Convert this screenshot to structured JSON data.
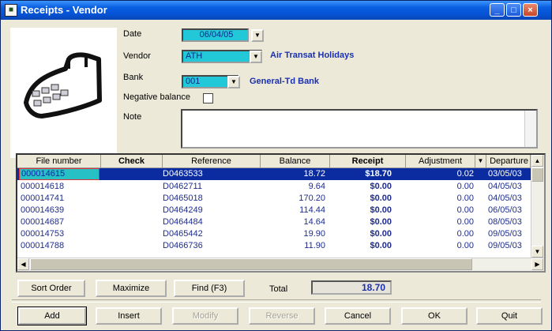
{
  "window": {
    "title": "Receipts - Vendor",
    "controls": {
      "minimize": "_",
      "maximize": "□",
      "close": "×"
    }
  },
  "form": {
    "date": {
      "label": "Date",
      "value": "06/04/05"
    },
    "vendor": {
      "label": "Vendor",
      "code": "ATH",
      "name": "Air Transat Holidays"
    },
    "bank": {
      "label": "Bank",
      "code": "001",
      "name": "General-Td Bank"
    },
    "negative_balance": {
      "label": "Negative balance",
      "checked": false
    },
    "note": {
      "label": "Note",
      "value": ""
    }
  },
  "grid": {
    "columns": [
      "File number",
      "Check",
      "Reference",
      "Balance",
      "Receipt",
      "Adjustment",
      "Departure"
    ],
    "rows": [
      {
        "file": "000014615",
        "check": "",
        "reference": "D0463533",
        "balance": "18.72",
        "receipt": "$18.70",
        "adjustment": "0.02",
        "departure": "03/05/03",
        "selected": true
      },
      {
        "file": "000014618",
        "check": "",
        "reference": "D0462711",
        "balance": "9.64",
        "receipt": "$0.00",
        "adjustment": "0.00",
        "departure": "04/05/03"
      },
      {
        "file": "000014741",
        "check": "",
        "reference": "D0465018",
        "balance": "170.20",
        "receipt": "$0.00",
        "adjustment": "0.00",
        "departure": "04/05/03"
      },
      {
        "file": "000014639",
        "check": "",
        "reference": "D0464249",
        "balance": "114.44",
        "receipt": "$0.00",
        "adjustment": "0.00",
        "departure": "06/05/03"
      },
      {
        "file": "000014687",
        "check": "",
        "reference": "D0464484",
        "balance": "14.64",
        "receipt": "$0.00",
        "adjustment": "0.00",
        "departure": "08/05/03"
      },
      {
        "file": "000014753",
        "check": "",
        "reference": "D0465442",
        "balance": "19.90",
        "receipt": "$0.00",
        "adjustment": "0.00",
        "departure": "09/05/03"
      },
      {
        "file": "000014788",
        "check": "",
        "reference": "D0466736",
        "balance": "11.90",
        "receipt": "$0.00",
        "adjustment": "0.00",
        "departure": "09/05/03"
      }
    ]
  },
  "toolbar": {
    "sort_order": "Sort Order",
    "maximize": "Maximize",
    "find": "Find (F3)",
    "total_label": "Total",
    "total_value": "18.70"
  },
  "actions": {
    "add": "Add",
    "insert": "Insert",
    "modify": "Modify",
    "reverse": "Reverse",
    "cancel": "Cancel",
    "ok": "OK",
    "quit": "Quit"
  },
  "colors": {
    "selection": "#0b2ca0",
    "field_bg": "#22c8d8",
    "link_blue": "#1a30b0"
  }
}
